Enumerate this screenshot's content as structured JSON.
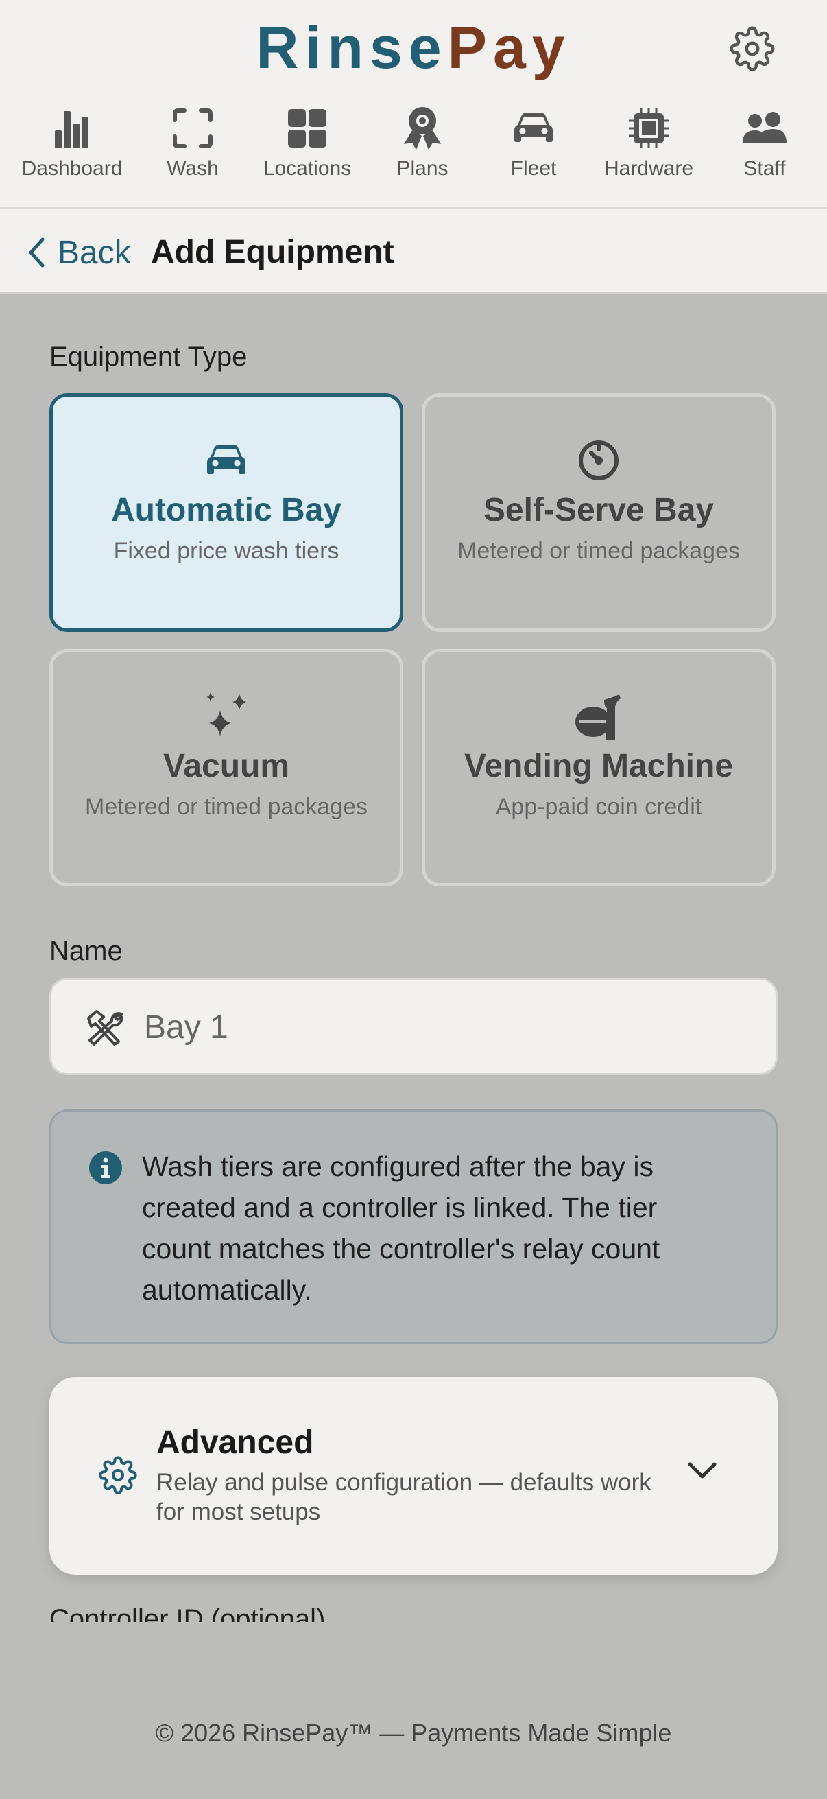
{
  "app": {
    "logo_part1": "Rinse",
    "logo_part2": "Pay",
    "accent_color": "#235f74",
    "brand_color": "#7a3a1e"
  },
  "nav": {
    "items": [
      {
        "label": "Dashboard",
        "icon": "bar-chart-icon"
      },
      {
        "label": "Wash",
        "icon": "scan-frame-icon"
      },
      {
        "label": "Locations",
        "icon": "grid-icon"
      },
      {
        "label": "Plans",
        "icon": "award-icon"
      },
      {
        "label": "Fleet",
        "icon": "car-icon"
      },
      {
        "label": "Hardware",
        "icon": "chip-icon"
      },
      {
        "label": "Staff",
        "icon": "people-icon"
      }
    ]
  },
  "subheader": {
    "back_label": "Back",
    "title": "Add Equipment"
  },
  "form": {
    "equipment_type_label": "Equipment Type",
    "types": [
      {
        "title": "Automatic Bay",
        "desc": "Fixed price wash tiers",
        "icon": "car-icon",
        "selected": true
      },
      {
        "title": "Self-Serve Bay",
        "desc": "Metered or timed packages",
        "icon": "gauge-icon",
        "selected": false
      },
      {
        "title": "Vacuum",
        "desc": "Metered or timed packages",
        "icon": "sparkles-icon",
        "selected": false
      },
      {
        "title": "Vending Machine",
        "desc": "App-paid coin credit",
        "icon": "coin-hand-icon",
        "selected": false
      }
    ],
    "name_label": "Name",
    "name_placeholder": "Bay 1",
    "info_text": "Wash tiers are configured after the bay is created and a controller is linked. The tier count matches the controller's relay count automatically.",
    "advanced_title": "Advanced",
    "advanced_desc": "Relay and pulse configuration — defaults work for most setups",
    "controller_label": "Controller ID (optional)"
  },
  "footer": {
    "text": "© 2026 RinsePay™ — Payments Made Simple"
  }
}
